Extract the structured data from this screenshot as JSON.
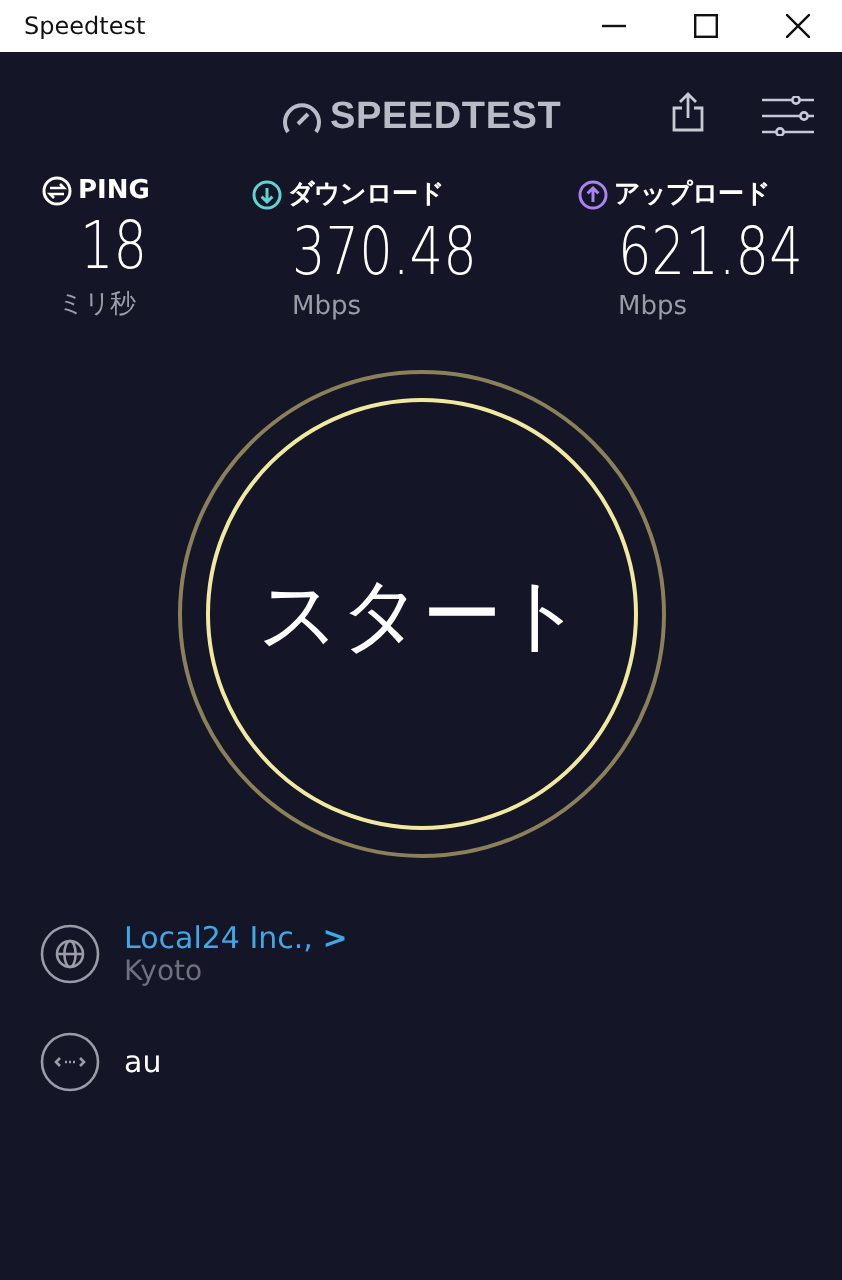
{
  "window": {
    "title": "Speedtest"
  },
  "header": {
    "logo": "SPEEDTEST"
  },
  "metrics": [
    {
      "kind": "ping",
      "label": "PING",
      "value": "18",
      "unit": "ミリ秒",
      "color": "#ffffff"
    },
    {
      "kind": "download",
      "label": "ダウンロード",
      "value": "370.48",
      "unit": "Mbps",
      "color": "#5fd4d0"
    },
    {
      "kind": "upload",
      "label": "アップロード",
      "value": "621.84",
      "unit": "Mbps",
      "color": "#a983f0"
    }
  ],
  "start_button": {
    "label": "スタート"
  },
  "server": {
    "name": "Local24 Inc.,",
    "arrow": ">",
    "location": "Kyoto"
  },
  "provider": {
    "name": "au"
  }
}
